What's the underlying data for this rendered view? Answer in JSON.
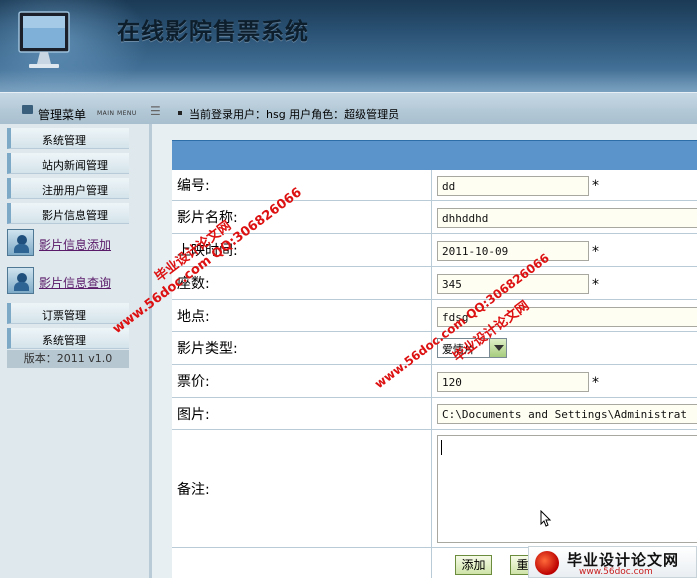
{
  "app": {
    "title": "在线影院售票系统"
  },
  "topbar": {
    "menu_label": "管理菜单",
    "menu_en": "MAIN MENU",
    "user_info": "当前登录用户：hsg  用户角色：超级管理员"
  },
  "sidebar": {
    "items": [
      {
        "label": "系统管理"
      },
      {
        "label": "站内新闻管理"
      },
      {
        "label": "注册用户管理"
      },
      {
        "label": "影片信息管理"
      }
    ],
    "subitems": [
      {
        "label": "影片信息添加"
      },
      {
        "label": "影片信息查询"
      }
    ],
    "items2": [
      {
        "label": "订票管理"
      },
      {
        "label": "系统管理"
      }
    ],
    "version": "版本：2011 v1.0"
  },
  "form": {
    "fields": [
      {
        "label": "编号:",
        "value": "dd",
        "required": "*"
      },
      {
        "label": "影片名称:",
        "value": "dhhddhd",
        "required": ""
      },
      {
        "label": "上映时间:",
        "value": "2011-10-09",
        "required": "*"
      },
      {
        "label": "座数:",
        "value": "345",
        "required": "*"
      },
      {
        "label": "地点:",
        "value": "fdsg",
        "required": ""
      },
      {
        "label": "影片类型:",
        "value": "爱情片",
        "required": ""
      },
      {
        "label": "票价:",
        "value": "120",
        "required": "*"
      },
      {
        "label": "图片:",
        "value": "C:\\Documents and Settings\\Administrat",
        "required": ""
      },
      {
        "label": "备注:",
        "value": "",
        "required": ""
      }
    ],
    "submit_label": "添加",
    "reset_label": "重置"
  },
  "watermarks": [
    "www.56doc.com  QQ:306826066",
    "毕业设计论文网",
    "www.56doc.com  QQ:306826066",
    "毕业设计论文网"
  ],
  "logo": {
    "text": "毕业设计论文网",
    "url": "www.56doc.com"
  },
  "colors": {
    "banner": "#2a5274",
    "form_header": "#5b94cb",
    "watermark": "#d11111"
  }
}
